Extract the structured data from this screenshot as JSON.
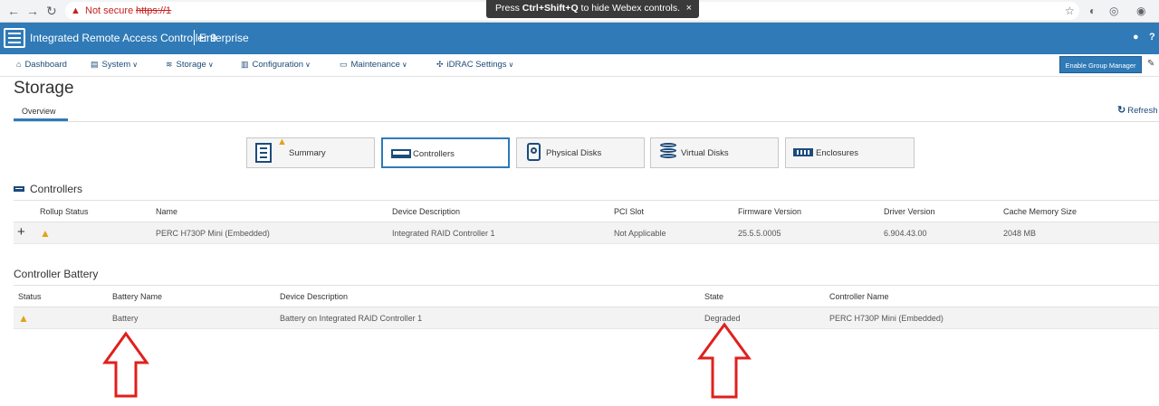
{
  "browser": {
    "not_secure": "Not secure",
    "url_prefix": "https://1",
    "url_rest": "",
    "webex_prefix": "Press ",
    "webex_keys": "Ctrl+Shift+Q",
    "webex_suffix": " to hide Webex controls.",
    "webex_close": "×"
  },
  "header": {
    "title": "Integrated Remote Access Controller 9",
    "edition": "Enterprise"
  },
  "menu": {
    "dashboard": "Dashboard",
    "system": "System",
    "storage": "Storage",
    "configuration": "Configuration",
    "maintenance": "Maintenance",
    "idrac_settings": "iDRAC Settings",
    "group_manager": "Enable Group Manager"
  },
  "page": {
    "title": "Storage",
    "tab": "Overview",
    "refresh": "Refresh"
  },
  "categories": {
    "summary": "Summary",
    "controllers": "Controllers",
    "physical_disks": "Physical Disks",
    "virtual_disks": "Virtual Disks",
    "enclosures": "Enclosures"
  },
  "controllers": {
    "title": "Controllers",
    "headers": {
      "rollup": "Rollup Status",
      "name": "Name",
      "desc": "Device Description",
      "pci": "PCI Slot",
      "fw": "Firmware Version",
      "driver": "Driver Version",
      "cache": "Cache Memory Size"
    },
    "row": {
      "expand": "+",
      "name": "PERC H730P Mini (Embedded)",
      "desc": "Integrated RAID Controller 1",
      "pci": "Not Applicable",
      "fw": "25.5.5.0005",
      "driver": "6.904.43.00",
      "cache": "2048 MB"
    }
  },
  "battery": {
    "title": "Controller Battery",
    "headers": {
      "status": "Status",
      "name": "Battery Name",
      "desc": "Device Description",
      "state": "State",
      "controller": "Controller Name"
    },
    "row": {
      "name": "Battery",
      "desc": "Battery on Integrated RAID Controller 1",
      "state": "Degraded",
      "controller": "PERC H730P Mini (Embedded)"
    }
  },
  "colors": {
    "header_blue": "#2f7ab7",
    "warning": "#e3a21a",
    "annotation_red": "#e0201c"
  }
}
